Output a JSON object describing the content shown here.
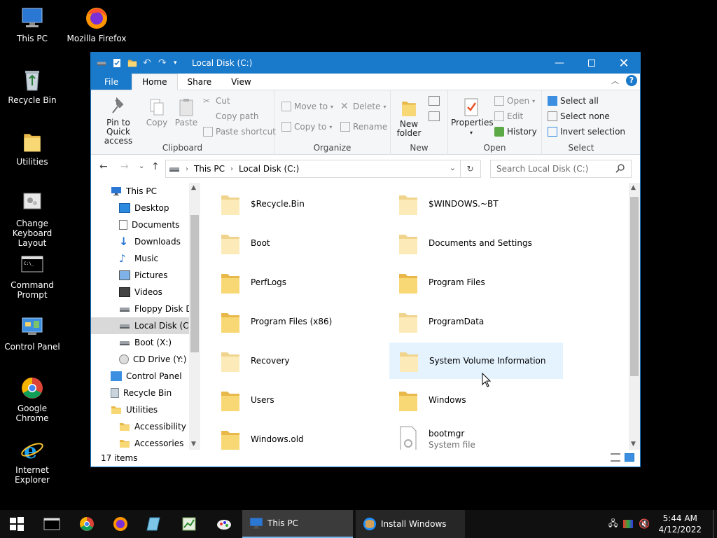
{
  "desktop": {
    "icons": [
      {
        "label": "This PC"
      },
      {
        "label": "Mozilla Firefox"
      },
      {
        "label": "Recycle Bin"
      },
      {
        "label": "Utilities"
      },
      {
        "label": "Change Keyboard Layout"
      },
      {
        "label": "Command Prompt"
      },
      {
        "label": "Control Panel"
      },
      {
        "label": "Google Chrome"
      },
      {
        "label": "Internet Explorer"
      }
    ]
  },
  "window": {
    "title": "Local Disk (C:)",
    "tabs": [
      {
        "label": "File"
      },
      {
        "label": "Home"
      },
      {
        "label": "Share"
      },
      {
        "label": "View"
      }
    ],
    "help_label": "?",
    "ribbon": {
      "clipboard": {
        "name": "Clipboard",
        "pin": "Pin to Quick access",
        "copy": "Copy",
        "paste": "Paste",
        "cut": "Cut",
        "copy_path": "Copy path",
        "paste_shortcut": "Paste shortcut"
      },
      "organize": {
        "name": "Organize",
        "move_to": "Move to",
        "copy_to": "Copy to",
        "delete": "Delete",
        "rename": "Rename"
      },
      "new": {
        "name": "New",
        "new_folder": "New folder"
      },
      "open": {
        "name": "Open",
        "properties": "Properties",
        "open": "Open",
        "edit": "Edit",
        "history": "History"
      },
      "select": {
        "name": "Select",
        "select_all": "Select all",
        "select_none": "Select none",
        "invert": "Invert selection"
      }
    },
    "address": {
      "crumbs": [
        "This PC",
        "Local Disk (C:)"
      ],
      "search_placeholder": "Search Local Disk (C:)"
    },
    "nav": [
      {
        "label": "This PC"
      },
      {
        "label": "Desktop"
      },
      {
        "label": "Documents"
      },
      {
        "label": "Downloads"
      },
      {
        "label": "Music"
      },
      {
        "label": "Pictures"
      },
      {
        "label": "Videos"
      },
      {
        "label": "Floppy Disk Dri"
      },
      {
        "label": "Local Disk (C:)"
      },
      {
        "label": "Boot (X:)"
      },
      {
        "label": "CD Drive (Y:) D"
      },
      {
        "label": "Control Panel"
      },
      {
        "label": "Recycle Bin"
      },
      {
        "label": "Utilities"
      },
      {
        "label": "Accessibility"
      },
      {
        "label": "Accessories"
      }
    ],
    "items": [
      {
        "name": "$Recycle.Bin"
      },
      {
        "name": "$WINDOWS.~BT"
      },
      {
        "name": "Boot"
      },
      {
        "name": "Documents and Settings"
      },
      {
        "name": "PerfLogs"
      },
      {
        "name": "Program Files"
      },
      {
        "name": "Program Files (x86)"
      },
      {
        "name": "ProgramData"
      },
      {
        "name": "Recovery"
      },
      {
        "name": "System Volume Information"
      },
      {
        "name": "Users"
      },
      {
        "name": "Windows"
      },
      {
        "name": "Windows.old"
      },
      {
        "name": "bootmgr",
        "sub": "System file"
      }
    ],
    "status": "17 items"
  },
  "taskbar": {
    "apps": [
      {
        "label": "This PC"
      },
      {
        "label": "Install Windows"
      }
    ],
    "time": "5:44 AM",
    "date": "4/12/2022"
  },
  "colors": {
    "accent": "#1979ca",
    "folder": "#f5d36b",
    "folder_light": "#fbe7a8"
  }
}
